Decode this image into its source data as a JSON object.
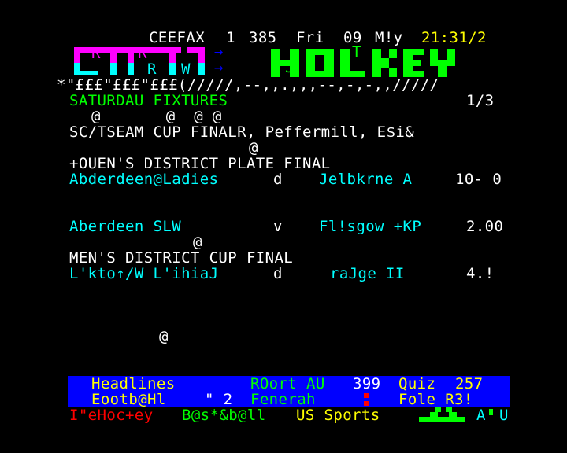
{
  "header": {
    "service": "CEEFAX",
    "mag": "1",
    "page": "385",
    "day": "Fri",
    "date": "09",
    "month": "M!y",
    "time": "21:31/2"
  },
  "logo": {
    "letters_r1": "R",
    "letters_r2": "R",
    "letters_r3": "R",
    "letters_w": "W",
    "arrow1": "→",
    "arrow2": "→",
    "hockey_t": "T",
    "hockey_j": "J",
    "title": "HOLKEY"
  },
  "rule": "*\"£££\"£££\"£££(/////,--,,.,,,--,-,-,,/////",
  "section": {
    "title": "SATURDAU FIXTURES",
    "page_count": "1/3"
  },
  "noise_rows": {
    "r5": "@       @  @ @",
    "r7": "@",
    "r14": "@",
    "r20": "@"
  },
  "match_lines": [
    {
      "id": "final_header",
      "text": "SC/TSEAM CUP FINALR, Peffermill, E$i&"
    },
    {
      "id": "plate_header",
      "text": "+OUEN'S DISTRICT PLATE FINAL"
    },
    {
      "id": "m1",
      "home": "Abderdeen@Ladies",
      "sep": "d",
      "away": "Jelbkrne A",
      "score": "10- 0"
    },
    {
      "id": "m2",
      "home": "Aberdeen SLW",
      "sep": "v",
      "away": "Fl!sgow +KP",
      "score": "2.00"
    },
    {
      "id": "cup_header",
      "text": "MEN'S DISTRICT CUP FINAL"
    },
    {
      "id": "m3",
      "home": "L'kto↑/W L'ihiaJ",
      "sep": "d",
      "away": "raJge II",
      "score": "4.!"
    }
  ],
  "footer": {
    "row1": {
      "a": "Headlines",
      "b": "ROort AU",
      "b_num": "399",
      "c": "Quiz",
      "c_num": "257"
    },
    "row2": {
      "a": "Eootb@Hl",
      "a_sym": "\" 2",
      "b": "Fenerah",
      "c": "Fole R3!"
    },
    "row3": {
      "a": "I\"eHoc+ey",
      "b": "B@s*&b@ll",
      "c": "US Sports",
      "d": "A",
      "e": "U"
    }
  },
  "colors": {
    "background": "#000000",
    "yellow": "#ffff00",
    "cyan": "#00ffff",
    "green": "#00ff00",
    "red": "#ff0000",
    "blue": "#0000ff",
    "magenta": "#ff00ff",
    "white": "#ffffff"
  }
}
